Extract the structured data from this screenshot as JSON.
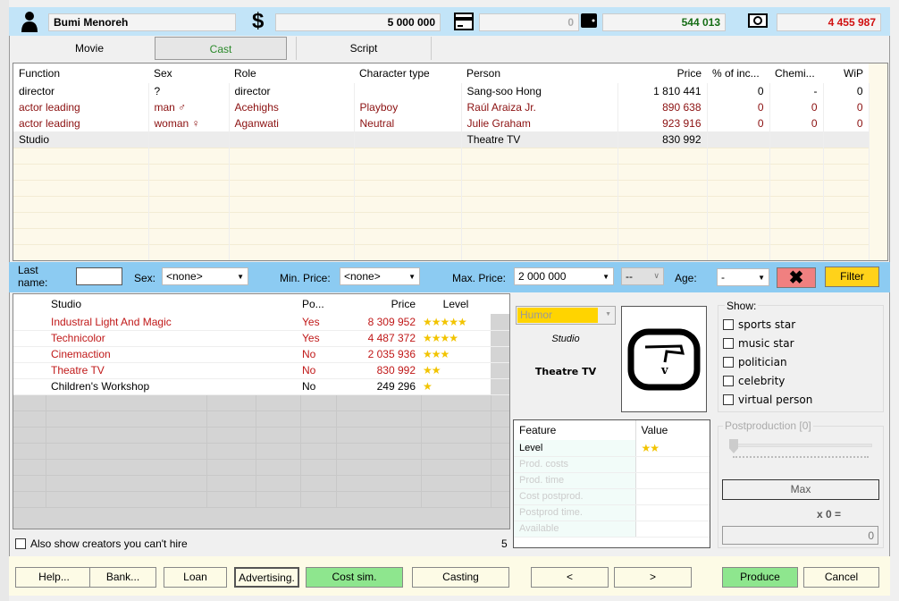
{
  "header": {
    "player_name": "Bumi Menoreh",
    "money": "5 000 000",
    "card": "0",
    "wallet": "544 013",
    "balance": "4 455 987",
    "icons": [
      "person-icon",
      "dollar-icon",
      "credit-card-icon",
      "wallet-icon",
      "money-bill-icon"
    ],
    "colors": {
      "wallet": "#166d16",
      "balance": "#d01010"
    }
  },
  "tabs": [
    {
      "label": "Movie"
    },
    {
      "label": "Cast",
      "selected": true
    },
    {
      "label": "Script"
    }
  ],
  "cast_table": {
    "columns": [
      "Function",
      "Sex",
      "Role",
      "Character type",
      "Person",
      "Price",
      "% of inc...",
      "Chemi...",
      "WiP"
    ],
    "rows": [
      [
        "director",
        "?",
        "director",
        "",
        "Sang-soo Hong",
        "1 810 441",
        "0",
        "-",
        "0"
      ],
      [
        "actor leading",
        "man ♂",
        "Acehighs",
        "Playboy",
        "Raúl Araiza Jr.",
        "890 638",
        "0",
        "0",
        "0"
      ],
      [
        "actor leading",
        "woman ♀",
        "Aganwati",
        "Neutral",
        "Julie Graham",
        "923 916",
        "0",
        "0",
        "0"
      ],
      [
        "Studio",
        "",
        "",
        "",
        "Theatre TV",
        "830 992",
        "",
        "",
        ""
      ]
    ]
  },
  "filter": {
    "last_name_label": "Last name:",
    "last_name_value": "",
    "sex_label": "Sex:",
    "sex_value": "<none>",
    "min_price_label": "Min. Price:",
    "min_price_value": "<none>",
    "max_price_label": "Max. Price:",
    "max_price_value": "2 000 000",
    "extra_value": "--",
    "age_label": "Age:",
    "age_value": "-",
    "clear_icon": "x-icon",
    "filter_label": "Filter"
  },
  "studio_list": {
    "columns": [
      "Studio",
      "Po...",
      "Price",
      "Level"
    ],
    "rows": [
      {
        "name": "Industral Light And Magic",
        "po": "Yes",
        "price": "8 309 952",
        "level": 5,
        "stars": "★★★★★",
        "hireable": false
      },
      {
        "name": "Technicolor",
        "po": "Yes",
        "price": "4 487 372",
        "level": 4,
        "stars": "★★★★",
        "hireable": false
      },
      {
        "name": "Cinemaction",
        "po": "No",
        "price": "2 035 936",
        "level": 3,
        "stars": "★★★",
        "hireable": false
      },
      {
        "name": "Theatre TV",
        "po": "No",
        "price": "830 992",
        "level": 2,
        "stars": "★★",
        "hireable": false
      },
      {
        "name": "Children's Workshop",
        "po": "No",
        "price": "249 296",
        "level": 1,
        "stars": "★",
        "hireable": true
      }
    ],
    "also_show_label": "Also show creators you can't hire",
    "count": "5"
  },
  "detail": {
    "genre": "Humor",
    "type": "Studio",
    "name": "Theatre TV",
    "logo": "theatre-tv-logo"
  },
  "show": {
    "title": "Show:",
    "options": [
      "sports star",
      "music star",
      "politician",
      "celebrity",
      "virtual person"
    ]
  },
  "features": {
    "columns": [
      "Feature",
      "Value"
    ],
    "rows": [
      {
        "name": "Level",
        "value": "★★",
        "level": 2
      },
      {
        "name": "Prod. costs",
        "value": ""
      },
      {
        "name": "Prod. time",
        "value": ""
      },
      {
        "name": "Cost postprod.",
        "value": ""
      },
      {
        "name": "Postprod time.",
        "value": ""
      },
      {
        "name": "Available",
        "value": ""
      }
    ]
  },
  "postproduction": {
    "title": "Postproduction [0]",
    "slider_value": 0,
    "max_label": "Max",
    "multiplier": "x 0 =",
    "result": "0"
  },
  "buttons": [
    "Help...",
    "Bank...",
    "Loan",
    "Advertising.",
    "Cost sim.",
    "Casting",
    "<",
    ">",
    "Produce",
    "Cancel"
  ]
}
